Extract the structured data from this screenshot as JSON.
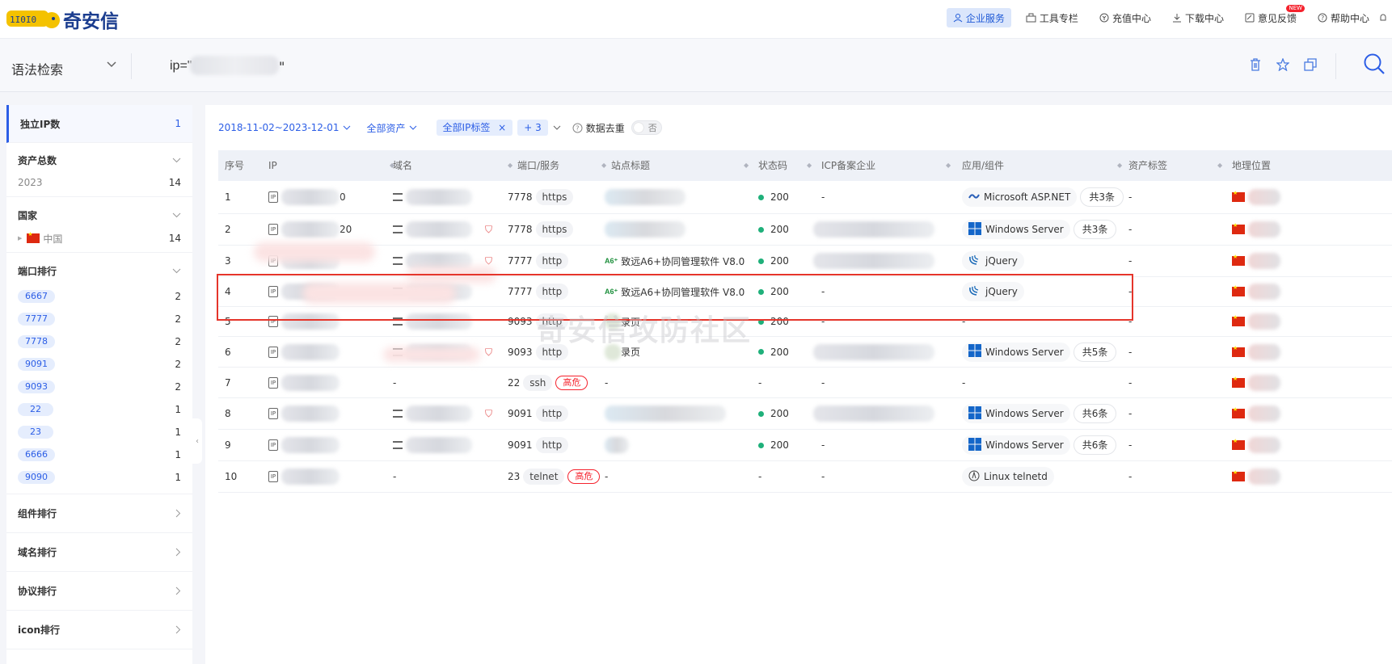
{
  "brand": {
    "name": "奇安信"
  },
  "topnav": [
    {
      "label": "企业服务",
      "icon": "user-service-icon",
      "active": true
    },
    {
      "label": "工具专栏",
      "icon": "toolbox-icon"
    },
    {
      "label": "充值中心",
      "icon": "recharge-icon"
    },
    {
      "label": "下载中心",
      "icon": "download-icon"
    },
    {
      "label": "意见反馈",
      "icon": "feedback-icon",
      "badge": "NEW"
    },
    {
      "label": "帮助中心",
      "icon": "help-icon"
    }
  ],
  "search": {
    "mode": "语法检索",
    "query_prefix": "ip=\"",
    "query_suffix": "\""
  },
  "sidebar": {
    "unique_ip": {
      "label": "独立IP数",
      "count": "1"
    },
    "total_assets": {
      "label": "资产总数",
      "rows": [
        {
          "name": "2023",
          "count": "14"
        }
      ]
    },
    "country": {
      "label": "国家",
      "rows": [
        {
          "name": "中国",
          "count": "14"
        }
      ]
    },
    "ports": {
      "label": "端口排行",
      "rows": [
        {
          "name": "6667",
          "count": "2"
        },
        {
          "name": "7777",
          "count": "2"
        },
        {
          "name": "7778",
          "count": "2"
        },
        {
          "name": "9091",
          "count": "2"
        },
        {
          "name": "9093",
          "count": "2"
        },
        {
          "name": "22",
          "count": "1"
        },
        {
          "name": "23",
          "count": "1"
        },
        {
          "name": "6666",
          "count": "1"
        },
        {
          "name": "9090",
          "count": "1"
        }
      ]
    },
    "collapsed": [
      {
        "label": "组件排行"
      },
      {
        "label": "域名排行"
      },
      {
        "label": "协议排行"
      },
      {
        "label": "icon排行"
      }
    ]
  },
  "filters": {
    "date_range": "2018-11-02~2023-12-01",
    "asset_scope": "全部资产",
    "ip_tag": "全部IP标签",
    "more": "+ 3",
    "dedupe_label": "数据去重",
    "dedupe_value": "否"
  },
  "table": {
    "columns": [
      "序号",
      "IP",
      "域名",
      "端口/服务",
      "站点标题",
      "状态码",
      "ICP备案企业",
      "应用/组件",
      "资产标签",
      "地理位置"
    ],
    "rows": [
      {
        "no": "1",
        "ip_tail": "0",
        "port": "7778",
        "service": "https",
        "title": "",
        "status": "200",
        "icp": "-",
        "component": "Microsoft ASP.NET",
        "comp_icon": "aspnet-icon",
        "comp_count": "共3条",
        "tag": "-"
      },
      {
        "no": "2",
        "ip_tail": "20",
        "port": "7778",
        "service": "https",
        "title": "",
        "status": "200",
        "icp": "",
        "component": "Windows Server",
        "comp_icon": "windows-icon",
        "comp_count": "共3条",
        "tag": "-"
      },
      {
        "no": "3",
        "ip_tail": "",
        "port": "7777",
        "service": "http",
        "title": "致远A6+协同管理软件 V8.0",
        "status": "200",
        "icp": "",
        "component": "jQuery",
        "comp_icon": "jquery-icon",
        "comp_count": "",
        "tag": "-"
      },
      {
        "no": "4",
        "ip_tail": "",
        "port": "7777",
        "service": "http",
        "title": "致远A6+协同管理软件 V8.0",
        "status": "200",
        "icp": "-",
        "component": "jQuery",
        "comp_icon": "jquery-icon",
        "comp_count": "",
        "tag": "-"
      },
      {
        "no": "5",
        "ip_tail": "",
        "port": "9093",
        "service": "http",
        "title": "录页",
        "status": "200",
        "icp": "-",
        "component": "-",
        "comp_icon": "",
        "comp_count": "",
        "tag": "-"
      },
      {
        "no": "6",
        "ip_tail": "",
        "port": "9093",
        "service": "http",
        "title": "录页",
        "status": "200",
        "icp": "",
        "component": "Windows Server",
        "comp_icon": "windows-icon",
        "comp_count": "共5条",
        "tag": "-"
      },
      {
        "no": "7",
        "ip_tail": "",
        "port": "22",
        "service": "ssh",
        "risk": "高危",
        "title": "-",
        "status": "-",
        "icp": "-",
        "component": "-",
        "comp_icon": "",
        "comp_count": "",
        "tag": "-"
      },
      {
        "no": "8",
        "ip_tail": "",
        "port": "9091",
        "service": "http",
        "title": "",
        "status": "200",
        "icp": "",
        "component": "Windows Server",
        "comp_icon": "windows-icon",
        "comp_count": "共6条",
        "tag": "-"
      },
      {
        "no": "9",
        "ip_tail": "",
        "port": "9091",
        "service": "http",
        "title": "",
        "status": "200",
        "icp": "-",
        "component": "Windows Server",
        "comp_icon": "windows-icon",
        "comp_count": "共6条",
        "tag": "-"
      },
      {
        "no": "10",
        "ip_tail": "",
        "port": "23",
        "service": "telnet",
        "risk": "高危",
        "title": "-",
        "status": "-",
        "icp": "-",
        "component": "Linux telnetd",
        "comp_icon": "linux-icon",
        "comp_count": "",
        "tag": "-"
      }
    ]
  },
  "watermark": "奇安信攻防社区",
  "colors": {
    "accent": "#2c5ee6",
    "ok": "#1fb07a",
    "danger": "#f5222d",
    "highlight": "#e5352b"
  }
}
